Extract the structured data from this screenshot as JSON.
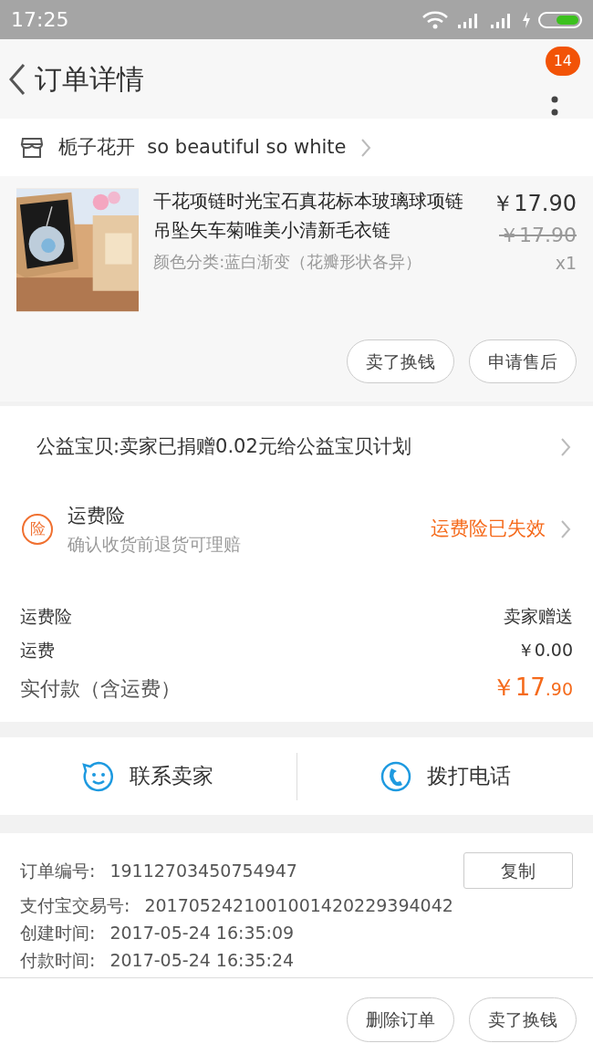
{
  "status_bar": {
    "time": "17:25"
  },
  "header": {
    "title": "订单详情",
    "badge": "14"
  },
  "shop": {
    "name": "栀子花开  so beautiful so white"
  },
  "product": {
    "kind": "picture",
    "title": "干花项链时光宝石真花标本玻璃球项链吊坠矢车菊唯美小清新毛衣链",
    "variant": "颜色分类:蓝白渐变（花瓣形状各异）",
    "price": "￥17.90",
    "original_price": "￥17.90",
    "quantity": "x1",
    "buttons": [
      "卖了换钱",
      "申请售后"
    ]
  },
  "charity": {
    "text": "公益宝贝:卖家已捐赠0.02元给公益宝贝计划"
  },
  "insurance": {
    "badge": "险",
    "title": "运费险",
    "subtitle": "确认收货前退货可理赔",
    "status": "运费险已失效"
  },
  "fees": [
    {
      "label": "运费险",
      "value": "卖家赠送"
    },
    {
      "label": "运费",
      "value": "￥0.00"
    }
  ],
  "total": {
    "label": "实付款（含运费）",
    "main": "￥17",
    "fraction": ".90"
  },
  "contact": [
    {
      "kind": "chat",
      "label": "联系卖家"
    },
    {
      "kind": "phone",
      "label": "拨打电话"
    }
  ],
  "order_info": {
    "copy_button": "复制",
    "rows": [
      {
        "label": "订单编号:",
        "value": "19112703450754947"
      },
      {
        "label": "支付宝交易号:",
        "value": "2017052421001001420229394042"
      },
      {
        "label": "创建时间:",
        "value": "2017-05-24 16:35:09"
      },
      {
        "label": "付款时间:",
        "value": "2017-05-24 16:35:24"
      }
    ]
  },
  "bottom_buttons": [
    "删除订单",
    "卖了换钱"
  ]
}
